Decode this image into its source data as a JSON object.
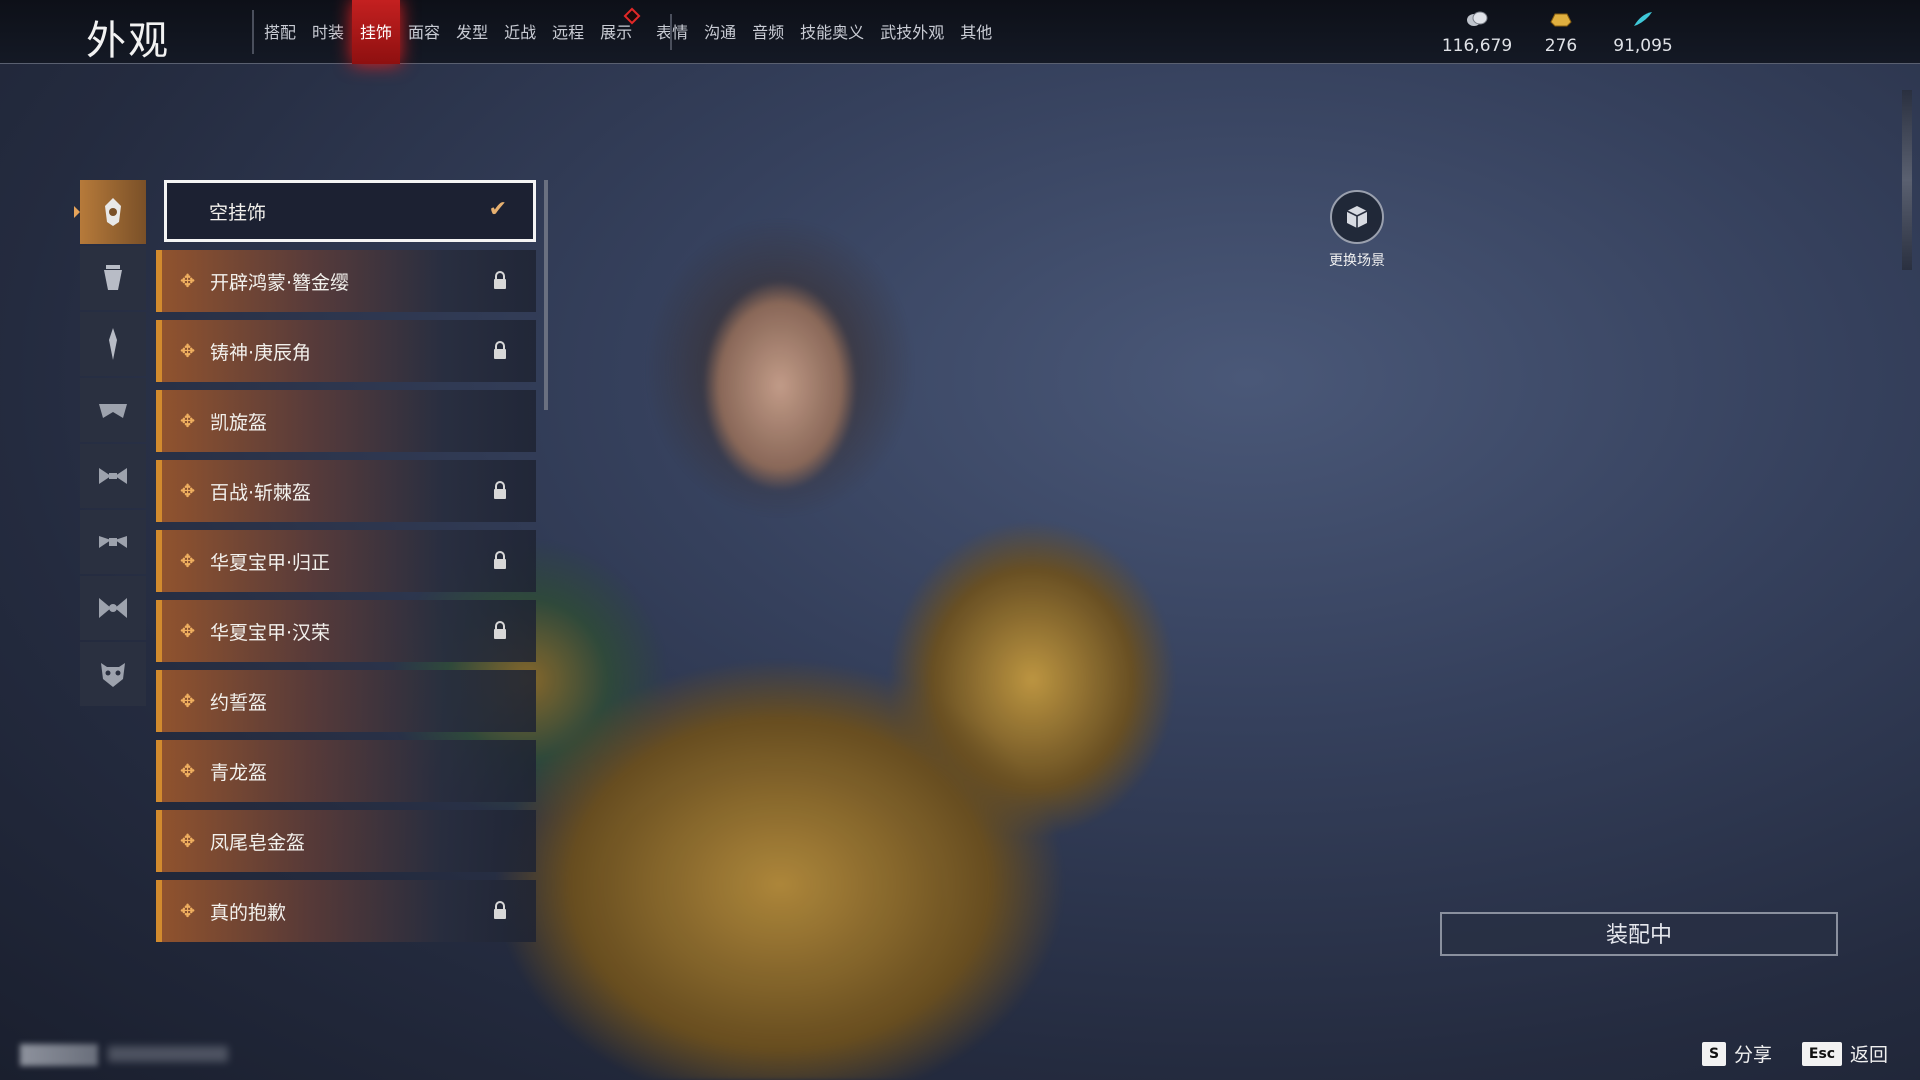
{
  "page_title": "外观",
  "tabs": [
    {
      "label": "搭配"
    },
    {
      "label": "时装"
    },
    {
      "label": "挂饰",
      "active": true
    },
    {
      "label": "面容"
    },
    {
      "label": "发型"
    },
    {
      "label": "近战"
    },
    {
      "label": "远程"
    },
    {
      "label": "展示",
      "badge": true
    },
    {
      "label": "表情"
    },
    {
      "label": "沟通"
    },
    {
      "label": "音频"
    },
    {
      "label": "技能奥义"
    },
    {
      "label": "武技外观"
    },
    {
      "label": "其他"
    }
  ],
  "currencies": [
    {
      "icon": "coin-stack-icon",
      "value": "116,679"
    },
    {
      "icon": "gold-ingot-icon",
      "value": "276"
    },
    {
      "icon": "jade-feather-icon",
      "value": "91,095"
    }
  ],
  "categories": [
    {
      "icon": "head-ornament-icon",
      "active": true
    },
    {
      "icon": "face-ornament-icon"
    },
    {
      "icon": "hairpin-icon"
    },
    {
      "icon": "shoulder-ornament-icon"
    },
    {
      "icon": "waist-ornament-icon"
    },
    {
      "icon": "back-ornament-icon"
    },
    {
      "icon": "tail-ornament-icon"
    },
    {
      "icon": "mask-icon"
    }
  ],
  "items": [
    {
      "label": "空挂饰",
      "selected": true,
      "locked": false
    },
    {
      "label": "开辟鸿蒙·簪金缨",
      "locked": true
    },
    {
      "label": "铸神·庚辰角",
      "locked": true
    },
    {
      "label": "凯旋盔",
      "locked": false
    },
    {
      "label": "百战·斩棘盔",
      "locked": true
    },
    {
      "label": "华夏宝甲·归正",
      "locked": true
    },
    {
      "label": "华夏宝甲·汉荣",
      "locked": true
    },
    {
      "label": "约誓盔",
      "locked": false
    },
    {
      "label": "青龙盔",
      "locked": false
    },
    {
      "label": "凤尾皂金盔",
      "locked": false
    },
    {
      "label": "真的抱歉",
      "locked": true
    }
  ],
  "scene_button": {
    "label": "更换场景"
  },
  "equip_button": {
    "label": "装配中"
  },
  "footer": {
    "share_key": "S",
    "share_label": "分享",
    "back_key": "Esc",
    "back_label": "返回"
  },
  "colors": {
    "accent": "#c42020",
    "item_border": "#d28b2e",
    "check": "#e6b070"
  }
}
